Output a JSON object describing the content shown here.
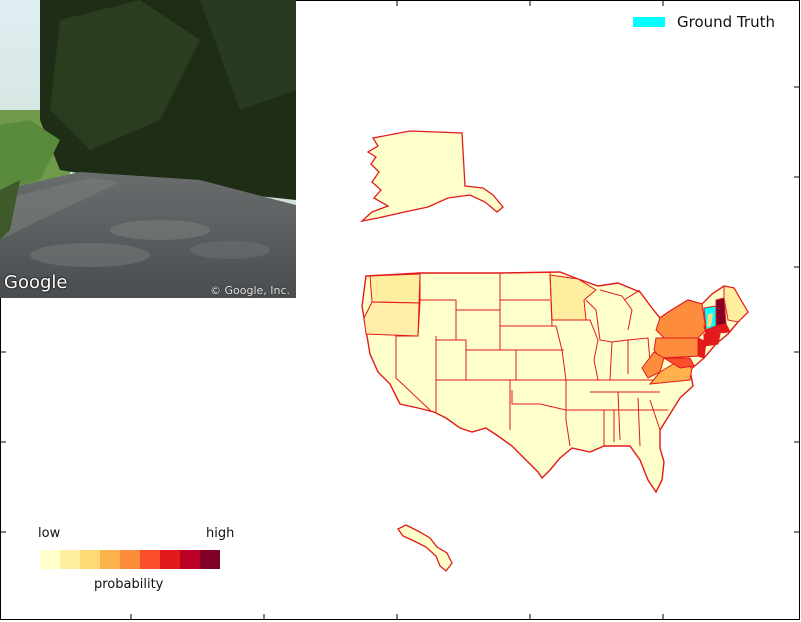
{
  "photo": {
    "logo_text": "Google",
    "copyright_text": "© Google, Inc."
  },
  "legend": {
    "label": "Ground Truth",
    "color": "#00ffff"
  },
  "colorbar": {
    "low_label": "low",
    "high_label": "high",
    "title": "probability",
    "colors": [
      "#ffffcc",
      "#ffeda0",
      "#fed976",
      "#feb24c",
      "#fd8d3c",
      "#fc4e2a",
      "#e31a1c",
      "#bd0026",
      "#800026"
    ]
  },
  "map": {
    "region": "United States",
    "ground_truth_state": "Vermont",
    "high_probability_states": [
      "Vermont",
      "New Hampshire",
      "Massachusetts",
      "Connecticut",
      "Rhode Island",
      "New York",
      "Pennsylvania",
      "New Jersey",
      "West Virginia",
      "Virginia",
      "Maryland",
      "Delaware"
    ],
    "border_color": "#e31a1c",
    "base_fill": "#ffffcc"
  }
}
